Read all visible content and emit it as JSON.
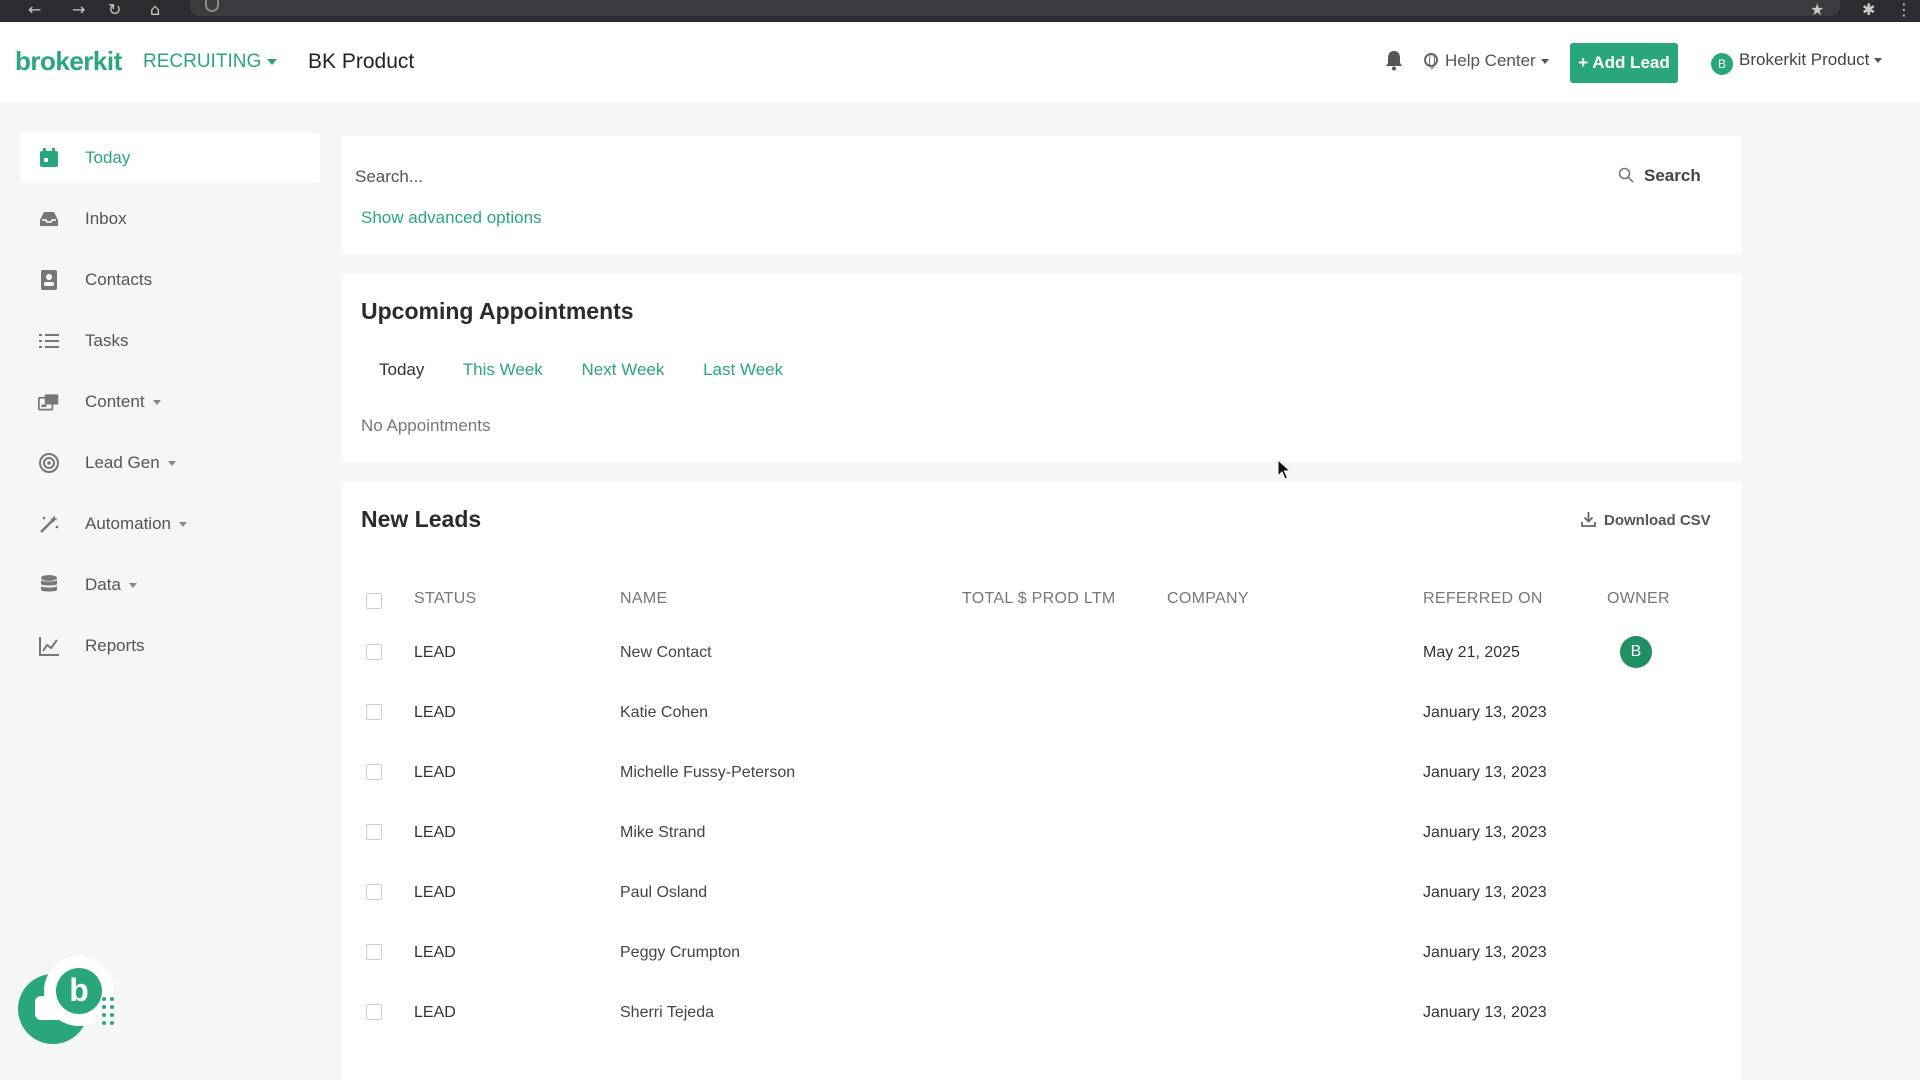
{
  "header": {
    "logo": "brokerkit",
    "module": "RECRUITING",
    "product_title": "BK Product",
    "help_label": "Help Center",
    "add_lead_label": "+ Add Lead",
    "user_avatar_letter": "B",
    "user_name": "Brokerkit Product"
  },
  "sidebar": {
    "items": [
      {
        "label": "Today",
        "icon": "calendar-icon",
        "active": true
      },
      {
        "label": "Inbox",
        "icon": "inbox-icon"
      },
      {
        "label": "Contacts",
        "icon": "contacts-icon"
      },
      {
        "label": "Tasks",
        "icon": "tasks-icon"
      },
      {
        "label": "Content",
        "icon": "content-icon",
        "dropdown": true
      },
      {
        "label": "Lead Gen",
        "icon": "lead-gen-icon",
        "dropdown": true
      },
      {
        "label": "Automation",
        "icon": "automation-icon",
        "dropdown": true
      },
      {
        "label": "Data",
        "icon": "database-icon",
        "dropdown": true
      },
      {
        "label": "Reports",
        "icon": "reports-icon"
      }
    ]
  },
  "search": {
    "placeholder": "Search...",
    "button_label": "Search",
    "advanced_link": "Show advanced options"
  },
  "appointments": {
    "title": "Upcoming Appointments",
    "tabs": [
      "Today",
      "This Week",
      "Next Week",
      "Last Week"
    ],
    "active_tab": "Today",
    "empty_text": "No Appointments"
  },
  "leads": {
    "title": "New Leads",
    "download_label": "Download CSV",
    "columns": [
      "STATUS",
      "NAME",
      "TOTAL $ PROD LTM",
      "COMPANY",
      "REFERRED ON",
      "OWNER"
    ],
    "rows": [
      {
        "status": "LEAD",
        "name": "New Contact",
        "prod": "",
        "company": "",
        "referred_on": "May 21, 2025",
        "owner": "B"
      },
      {
        "status": "LEAD",
        "name": "Katie Cohen",
        "prod": "",
        "company": "",
        "referred_on": "January 13, 2023",
        "owner": ""
      },
      {
        "status": "LEAD",
        "name": "Michelle Fussy-Peterson",
        "prod": "",
        "company": "",
        "referred_on": "January 13, 2023",
        "owner": ""
      },
      {
        "status": "LEAD",
        "name": "Mike Strand",
        "prod": "",
        "company": "",
        "referred_on": "January 13, 2023",
        "owner": ""
      },
      {
        "status": "LEAD",
        "name": "Paul Osland",
        "prod": "",
        "company": "",
        "referred_on": "January 13, 2023",
        "owner": ""
      },
      {
        "status": "LEAD",
        "name": "Peggy Crumpton",
        "prod": "",
        "company": "",
        "referred_on": "January 13, 2023",
        "owner": ""
      },
      {
        "status": "LEAD",
        "name": "Sherri Tejeda",
        "prod": "",
        "company": "",
        "referred_on": "January 13, 2023",
        "owner": ""
      }
    ]
  },
  "chat_widget": {
    "letter": "b"
  },
  "colors": {
    "brand_green": "#2aa77a",
    "owner_avatar": "#1f8f64"
  }
}
